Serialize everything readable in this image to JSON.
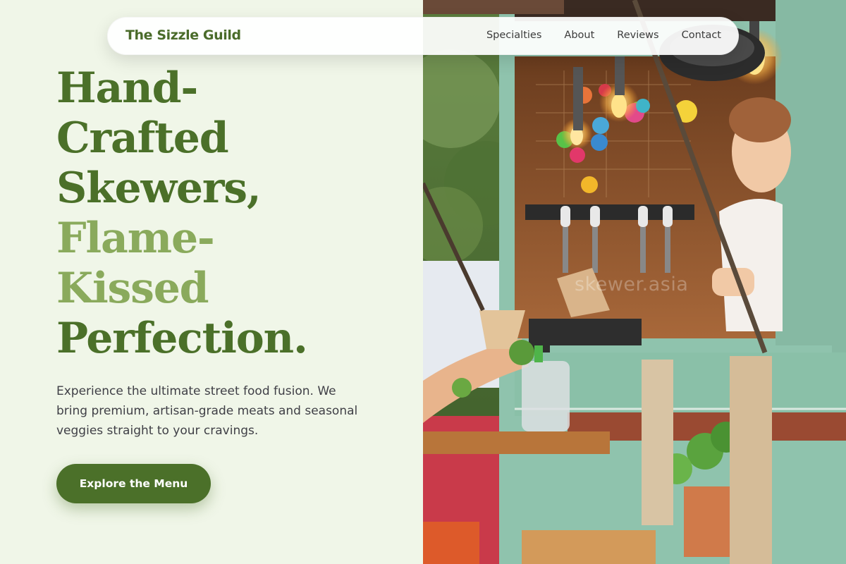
{
  "brand": {
    "name": "The Sizzle Guild"
  },
  "nav": {
    "links": [
      {
        "label": "Specialties"
      },
      {
        "label": "About"
      },
      {
        "label": "Reviews"
      },
      {
        "label": "Contact"
      }
    ]
  },
  "hero": {
    "headline": {
      "line1": "Hand-",
      "line2": "Crafted",
      "line3": "Skewers,",
      "line4": "Flame-",
      "line5": "Kissed",
      "line6": "Perfection."
    },
    "description": "Experience the ultimate street food fusion. We bring premium, artisan-grade meats and seasonal veggies straight to your cravings.",
    "cta_label": "Explore the Menu"
  },
  "photo": {
    "watermark": "skewer.asia"
  },
  "colors": {
    "brand_green": "#4b7029",
    "accent_light_green": "#8aaa5c",
    "page_background": "#f0f6e8",
    "truck_mint": "#8fc3ad"
  }
}
